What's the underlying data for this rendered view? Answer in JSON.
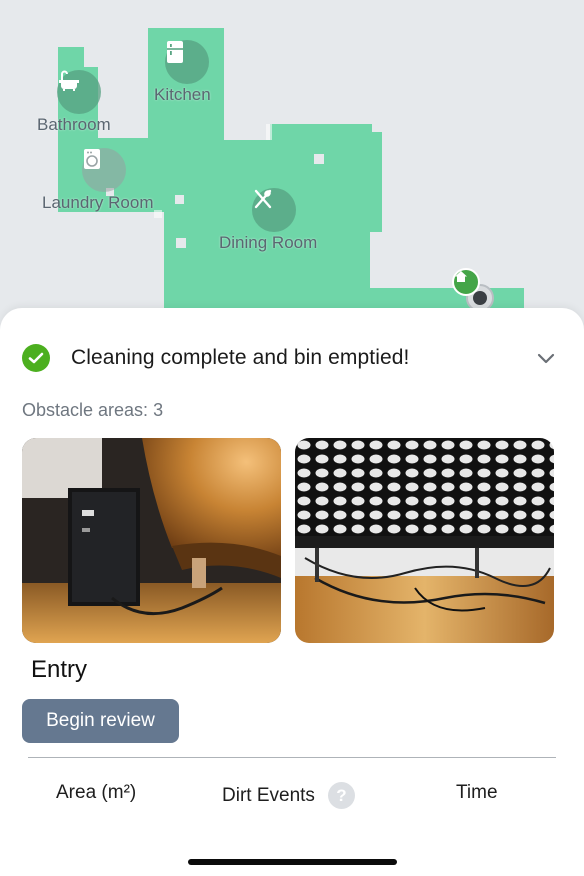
{
  "map": {
    "rooms": [
      {
        "name": "Kitchen",
        "icon": "fridge-icon"
      },
      {
        "name": "Bathroom",
        "icon": "bathtub-icon"
      },
      {
        "name": "Laundry Room",
        "icon": "washer-icon"
      },
      {
        "name": "Dining Room",
        "icon": "utensils-icon"
      }
    ],
    "dock_icon": "home-icon",
    "robot_icon": "robot-icon",
    "floor_color": "#6fd6a8"
  },
  "summary": {
    "status_icon": "check-icon",
    "status_text": "Cleaning complete and bin emptied!",
    "expand_icon": "chevron-down-icon",
    "obstacle_text": "Obstacle areas: 3",
    "obstacle_photos": [
      "photo-speaker-under-desk",
      "photo-mesh-and-cables"
    ],
    "area_name": "Entry",
    "review_button": "Begin review"
  },
  "stats": {
    "area_label": "Area (m²)",
    "dirt_label": "Dirt Events",
    "help_label": "?",
    "time_label": "Time"
  },
  "colors": {
    "accent_green": "#4caf1f",
    "button_blue": "#657890",
    "sheet_bg": "#ffffff",
    "map_bg": "#e6e9ec"
  }
}
